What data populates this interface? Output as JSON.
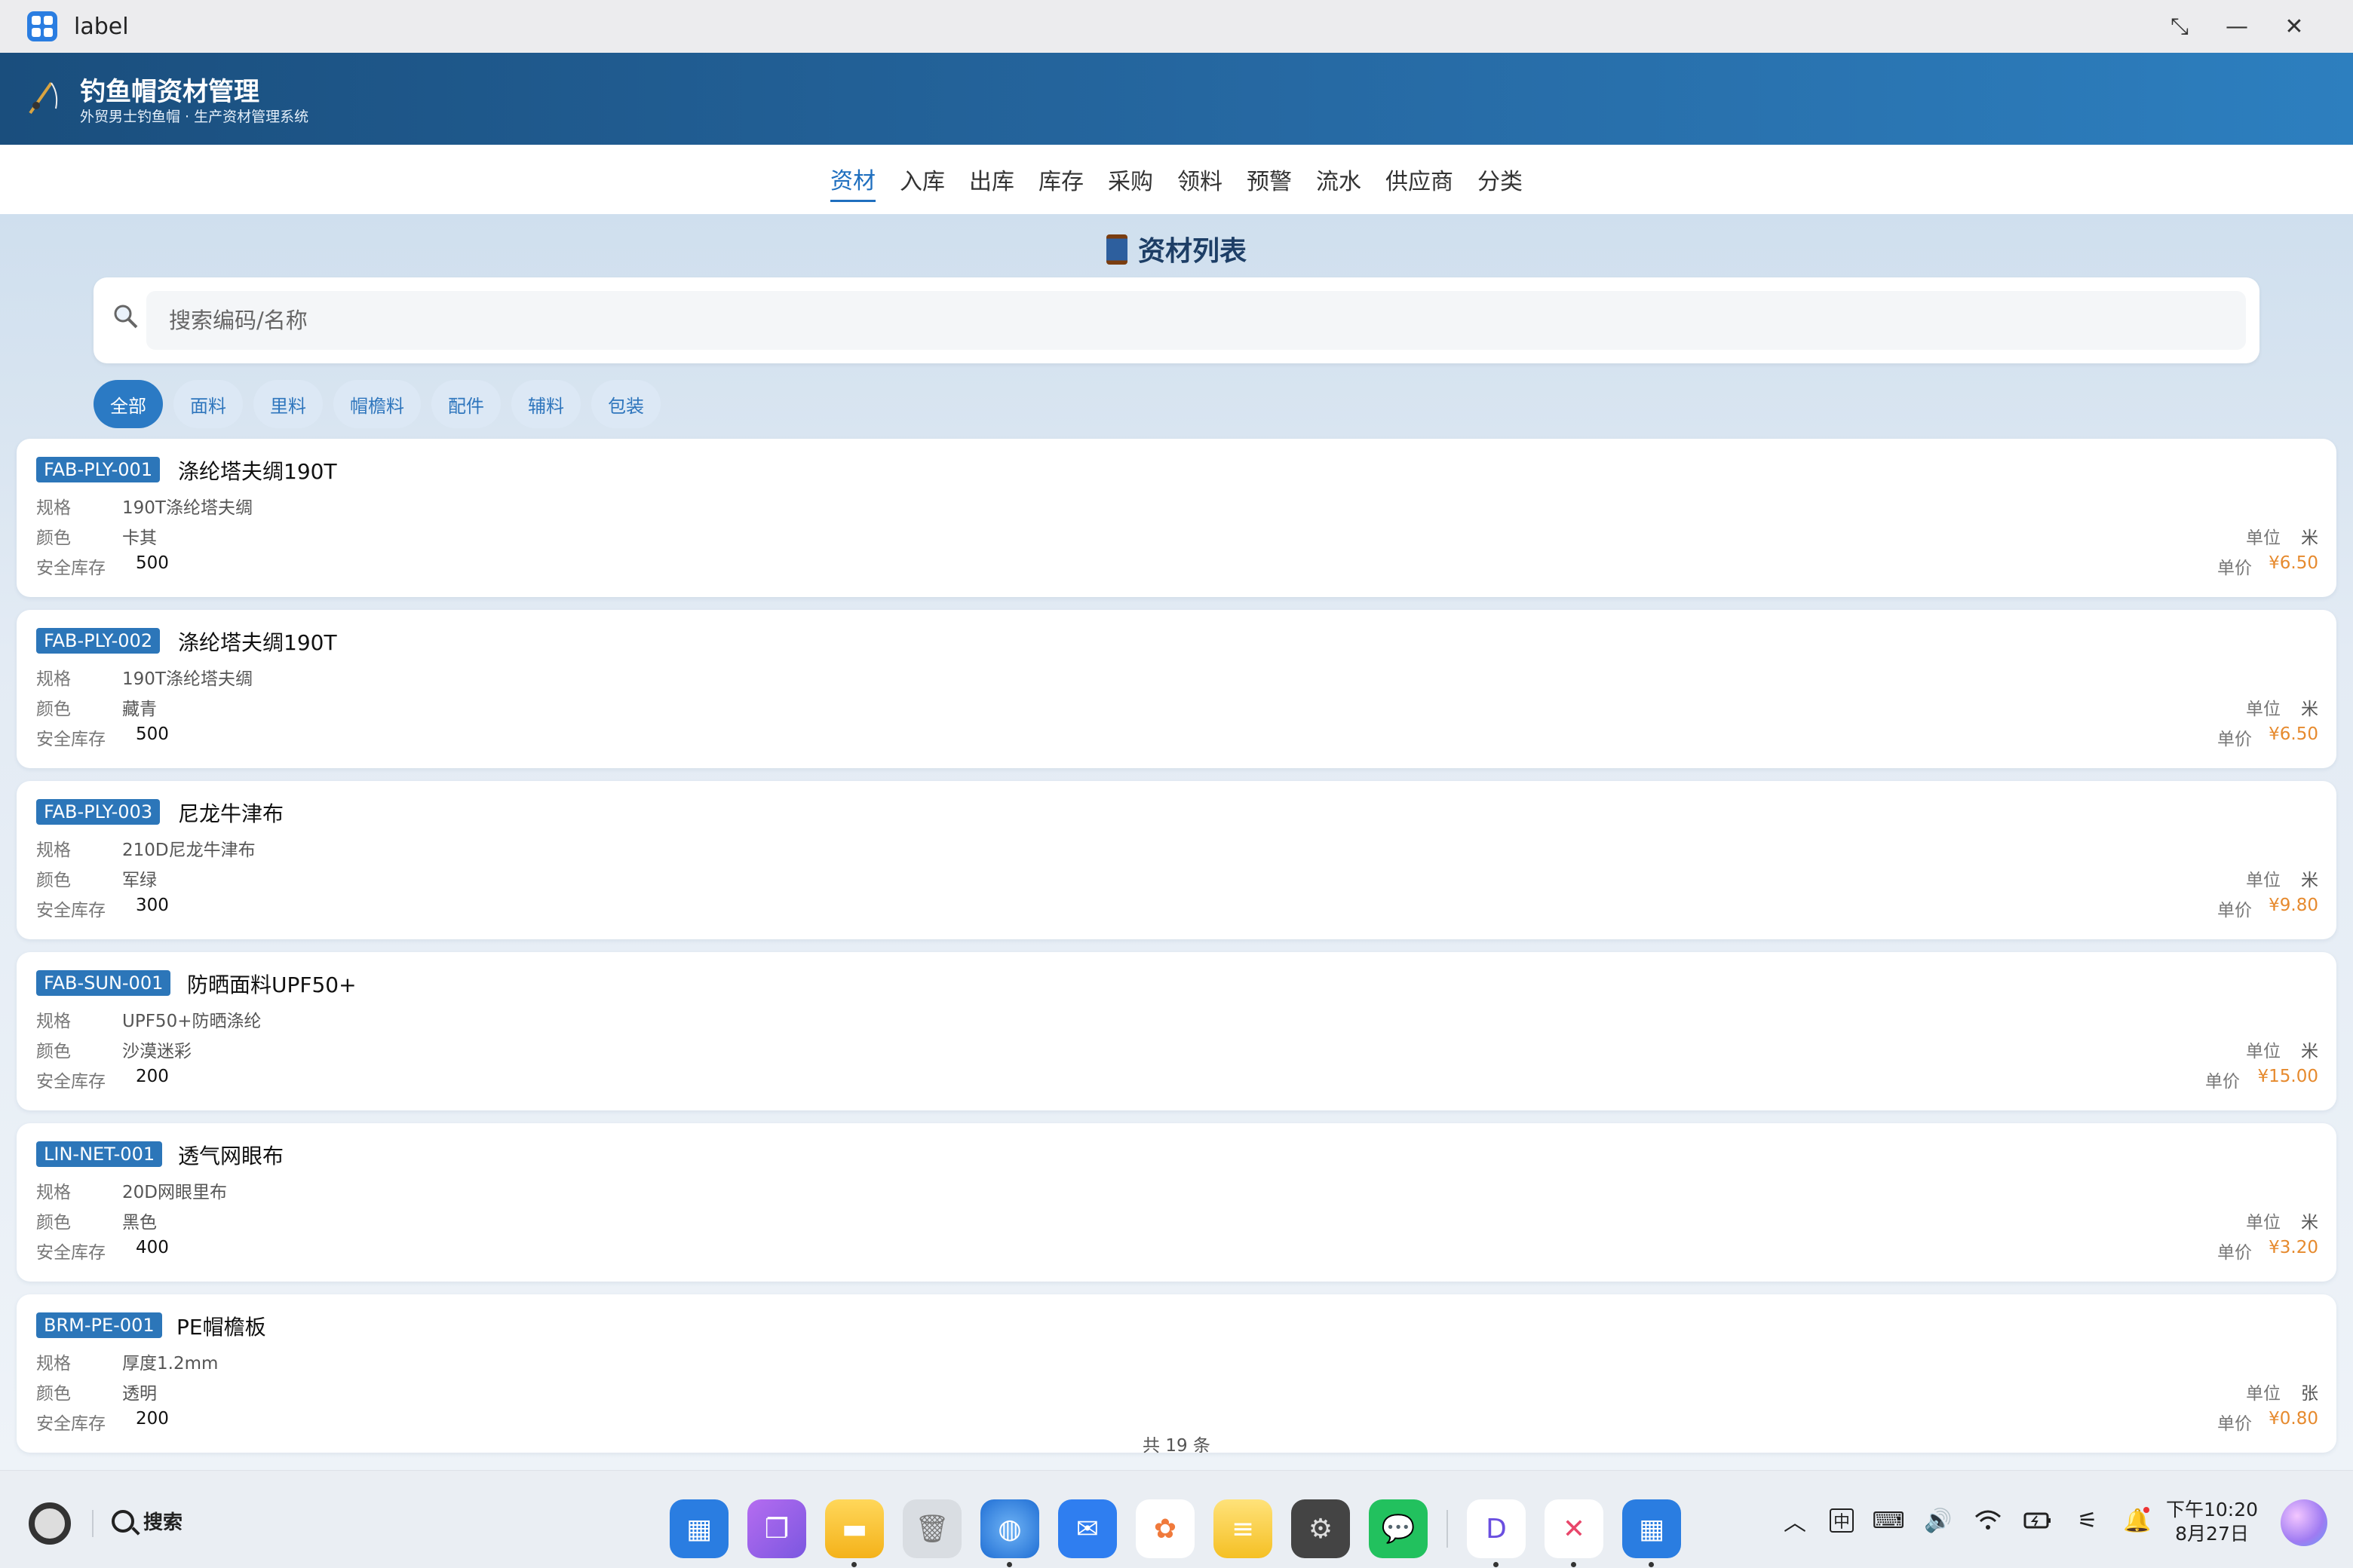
{
  "window": {
    "title": "label",
    "controls": [
      "restore",
      "minimize",
      "close"
    ]
  },
  "header": {
    "title": "钓鱼帽资材管理",
    "subtitle": "外贸男士钓鱼帽 · 生产资材管理系统"
  },
  "nav": {
    "items": [
      "资材",
      "入库",
      "出库",
      "库存",
      "采购",
      "领料",
      "预警",
      "流水",
      "供应商",
      "分类"
    ],
    "active_index": 0
  },
  "page": {
    "title": "资材列表"
  },
  "search": {
    "placeholder": "搜索编码/名称"
  },
  "filters": {
    "chips": [
      "全部",
      "面料",
      "里料",
      "帽檐料",
      "配件",
      "辅料",
      "包装"
    ],
    "active_index": 0
  },
  "labels": {
    "spec": "规格",
    "color": "颜色",
    "safety_stock": "安全库存",
    "unit": "单位",
    "unit_price": "单价"
  },
  "materials": [
    {
      "code": "FAB-PLY-001",
      "name": "涤纶塔夫绸190T",
      "spec": "190T涤纶塔夫绸",
      "color": "卡其",
      "safety_stock": "500",
      "unit": "米",
      "price": "¥6.50"
    },
    {
      "code": "FAB-PLY-002",
      "name": "涤纶塔夫绸190T",
      "spec": "190T涤纶塔夫绸",
      "color": "藏青",
      "safety_stock": "500",
      "unit": "米",
      "price": "¥6.50"
    },
    {
      "code": "FAB-PLY-003",
      "name": "尼龙牛津布",
      "spec": "210D尼龙牛津布",
      "color": "军绿",
      "safety_stock": "300",
      "unit": "米",
      "price": "¥9.80"
    },
    {
      "code": "FAB-SUN-001",
      "name": "防晒面料UPF50+",
      "spec": "UPF50+防晒涤纶",
      "color": "沙漠迷彩",
      "safety_stock": "200",
      "unit": "米",
      "price": "¥15.00"
    },
    {
      "code": "LIN-NET-001",
      "name": "透气网眼布",
      "spec": "20D网眼里布",
      "color": "黑色",
      "safety_stock": "400",
      "unit": "米",
      "price": "¥3.20"
    },
    {
      "code": "BRM-PE-001",
      "name": "PE帽檐板",
      "spec": "厚度1.2mm",
      "color": "透明",
      "safety_stock": "200",
      "unit": "张",
      "price": "¥0.80"
    }
  ],
  "footer": {
    "count_text": "共 19 条"
  },
  "taskbar": {
    "search_label": "搜索",
    "clock_time": "下午10:20",
    "clock_date": "8月27日",
    "ime_label": "中"
  },
  "colors": {
    "accent": "#2b7ac4",
    "header_dark": "#1a4e7d",
    "price": "#e68a2e"
  }
}
